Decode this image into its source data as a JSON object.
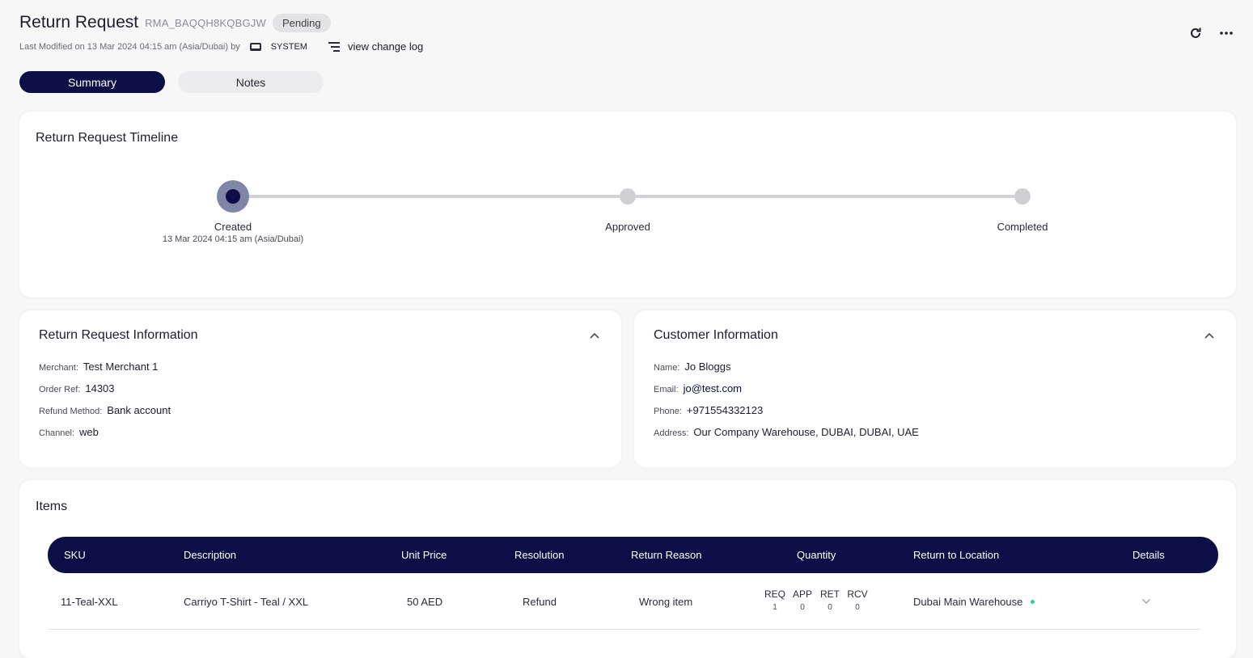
{
  "header": {
    "title": "Return Request",
    "rma_id": "RMA_BAQQH8KQBGJW",
    "status": "Pending",
    "last_modified": "Last Modified on 13 Mar 2024 04:15 am (Asia/Dubai) by",
    "modified_by": "SYSTEM",
    "change_log": "view change log"
  },
  "tabs": [
    {
      "label": "Summary",
      "active": true
    },
    {
      "label": "Notes",
      "active": false
    }
  ],
  "timeline": {
    "title": "Return Request Timeline",
    "steps": [
      {
        "label": "Created",
        "date": "13 Mar 2024 04:15 am (Asia/Dubai)",
        "active": true
      },
      {
        "label": "Approved",
        "date": "",
        "active": false
      },
      {
        "label": "Completed",
        "date": "",
        "active": false
      }
    ]
  },
  "return_info": {
    "title": "Return Request Information",
    "fields": [
      {
        "label": "Merchant:",
        "value": "Test Merchant 1"
      },
      {
        "label": "Order Ref:",
        "value": "14303"
      },
      {
        "label": "Refund Method:",
        "value": "Bank account"
      },
      {
        "label": "Channel:",
        "value": "web"
      }
    ]
  },
  "customer_info": {
    "title": "Customer Information",
    "fields": [
      {
        "label": "Name:",
        "value": "Jo Bloggs"
      },
      {
        "label": "Email:",
        "value": "jo@test.com"
      },
      {
        "label": "Phone:",
        "value": "+971554332123"
      },
      {
        "label": "Address:",
        "value": "Our Company Warehouse, DUBAI, DUBAI, UAE"
      }
    ]
  },
  "items": {
    "title": "Items",
    "columns": [
      "SKU",
      "Description",
      "Unit Price",
      "Resolution",
      "Return Reason",
      "Quantity",
      "Return to Location",
      "Details"
    ],
    "rows": [
      {
        "sku": "11-Teal-XXL",
        "description": "Carriyo T-Shirt - Teal / XXL",
        "unit_price": "50 AED",
        "resolution": "Refund",
        "reason": "Wrong item",
        "quantity": {
          "req_label": "REQ",
          "req": "1",
          "app_label": "APP",
          "app": "0",
          "ret_label": "RET",
          "ret": "0",
          "rcv_label": "RCV",
          "rcv": "0"
        },
        "location": "Dubai Main Warehouse"
      }
    ]
  },
  "colors": {
    "brand_navy": "#0b0f45",
    "status_dot": "#2fd28a"
  }
}
